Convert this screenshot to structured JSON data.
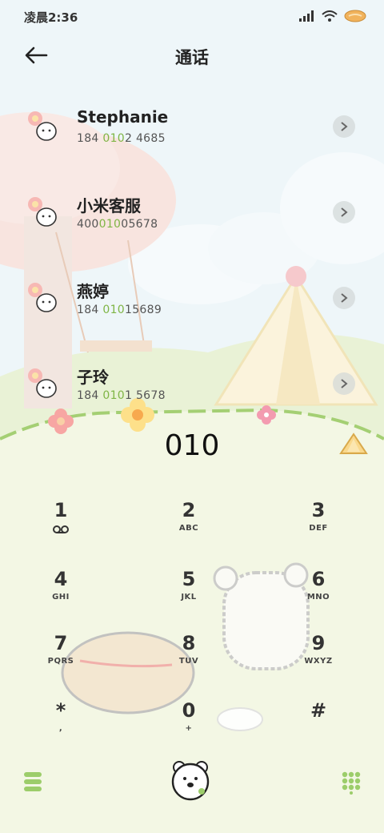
{
  "status": {
    "time": "凌晨2:36",
    "icons": [
      "signal-icon",
      "wifi-icon",
      "battery-icon"
    ]
  },
  "header": {
    "title": "通话",
    "back_icon": "back-arrow-icon"
  },
  "contacts": [
    {
      "name": "Stephanie",
      "num_pre": "184 ",
      "num_hl": "010",
      "num_post": "2 4685"
    },
    {
      "name": "小米客服",
      "num_pre": "400",
      "num_hl": "010",
      "num_post": "05678"
    },
    {
      "name": "燕婷",
      "num_pre": "184 ",
      "num_hl": "010",
      "num_post": "15689"
    },
    {
      "name": "子玲",
      "num_pre": "184 ",
      "num_hl": "010",
      "num_post": "1 5678"
    }
  ],
  "dial": {
    "input": "010"
  },
  "keypad": [
    {
      "digit": "1",
      "letters": ""
    },
    {
      "digit": "2",
      "letters": "ABC"
    },
    {
      "digit": "3",
      "letters": "DEF"
    },
    {
      "digit": "4",
      "letters": "GHI"
    },
    {
      "digit": "5",
      "letters": "JKL"
    },
    {
      "digit": "6",
      "letters": "MNO"
    },
    {
      "digit": "7",
      "letters": "PQRS"
    },
    {
      "digit": "8",
      "letters": "TUV"
    },
    {
      "digit": "9",
      "letters": "WXYZ"
    },
    {
      "digit": "*",
      "letters": ","
    },
    {
      "digit": "0",
      "letters": "+"
    },
    {
      "digit": "#",
      "letters": ""
    }
  ],
  "colors": {
    "accent_green": "#7fb545",
    "hill": "#f3f7e4",
    "tree_pink": "#f7dcd6"
  },
  "bottom": {
    "left_icon": "menu-icon",
    "center_icon": "call-bear-icon",
    "right_icon": "dialpad-grid-icon"
  }
}
